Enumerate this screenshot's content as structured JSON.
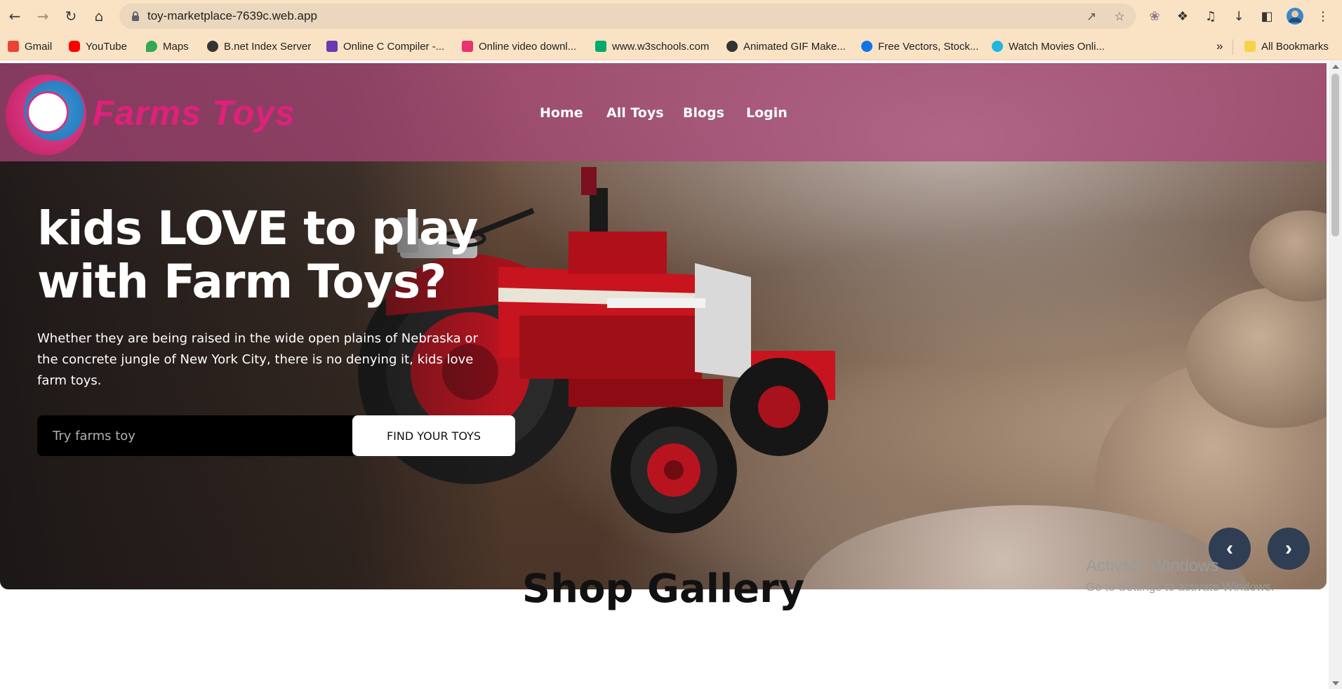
{
  "browser": {
    "url": "toy-marketplace-7639c.web.app",
    "bookmarks": [
      {
        "label": "Gmail",
        "icon": "gmail-icon",
        "color": "#ea4335"
      },
      {
        "label": "YouTube",
        "icon": "youtube-icon",
        "color": "#ff0000"
      },
      {
        "label": "Maps",
        "icon": "maps-icon",
        "color": "#34a853"
      },
      {
        "label": "B.net Index Server",
        "icon": "globe-icon",
        "color": "#333333"
      },
      {
        "label": "Online C Compiler -...",
        "icon": "compiler-icon",
        "color": "#6a3ab2"
      },
      {
        "label": "Online video downl...",
        "icon": "download-icon",
        "color": "#e8336d"
      },
      {
        "label": "www.w3schools.com",
        "icon": "w3schools-icon",
        "color": "#04aa6d"
      },
      {
        "label": "Animated GIF Make...",
        "icon": "globe-icon",
        "color": "#333333"
      },
      {
        "label": "Free Vectors, Stock...",
        "icon": "vector-icon",
        "color": "#1273eb"
      },
      {
        "label": "Watch Movies Onli...",
        "icon": "play-icon",
        "color": "#1fb6e0"
      }
    ],
    "all_bookmarks": "All Bookmarks"
  },
  "site": {
    "logo_text": "Farms Toys",
    "nav": [
      "Home",
      "All Toys",
      "Blogs",
      "Login"
    ]
  },
  "hero": {
    "title": "kids LOVE to play with Farm Toys?",
    "text": "Whether they are being raised in the wide open plains of Nebraska or the concrete jungle of New York City, there is no denying it, kids love farm toys.",
    "search_placeholder": "Try farms toy",
    "button": "FIND YOUR TOYS",
    "prev": "‹",
    "next": "›"
  },
  "gallery": {
    "title": "Shop Gallery"
  },
  "watermark": {
    "line1": "Activate Windows",
    "line2": "Go to Settings to activate Windows."
  },
  "colors": {
    "chrome": "#fae3c4",
    "header_band": "#aa4678",
    "logo_pink": "#e0207a",
    "carousel_button": "#2f3e52",
    "tractor_red": "#c8141e"
  }
}
